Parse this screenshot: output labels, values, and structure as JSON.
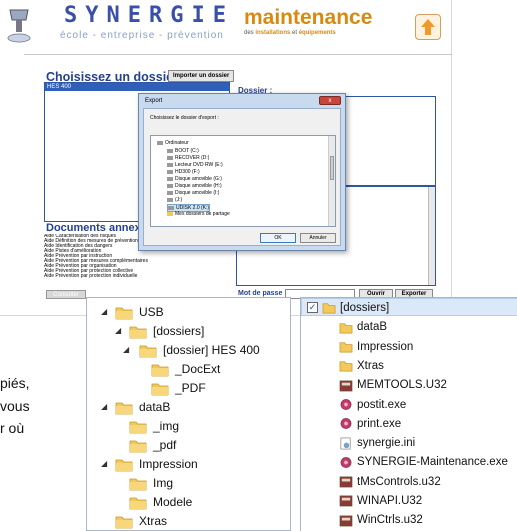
{
  "app": {
    "brand": "SYNERGIE",
    "tagline": "école - entreprise - prévention",
    "maint_title": "maintenance",
    "maint_sub_pre": "des ",
    "maint_sub_b1": "installations",
    "maint_sub_mid": " et ",
    "maint_sub_b2": "équipements",
    "choose_title": "Choisissez un dossier",
    "import_label": "Importer un dossier",
    "folder_selected": "HES 400",
    "dossier_title": "Dossier :",
    "annex_title": "Documents annexes dis",
    "annex_items": [
      "Aide Caractérisation des risques",
      "Aide Définition des mesures de prévention",
      "Aide Identification des dangers",
      "Aide Pistes d'amélioration",
      "Aide Prévention par instruction",
      "Aide Prévention par mesures complémentaires",
      "Aide Prévention par organisation",
      "Aide Prévention par protection collective",
      "Aide Prévention par protection individuelle"
    ],
    "consult_label": "Consulter",
    "password_label": "Mot de passe :",
    "open_label": "Ouvrir",
    "export_label": "Exporter"
  },
  "dialog": {
    "title": "Export",
    "close": "x",
    "prompt": "Choisissez le dossier d'export :",
    "tree": [
      "Ordinateur",
      "BOOT (C:)",
      "RECOVER (D:)",
      "Lecteur DVD RW (E:)",
      "HD300 (F:)",
      "Disque amovible (G:)",
      "Disque amovible (H:)",
      "Disque amovible (I:)",
      "(J:)",
      "UDISK 2.0 (K:)",
      "Mes dossiers de partage"
    ],
    "ok": "OK",
    "cancel": "Annuler"
  },
  "fragments": [
    "piés,",
    "vous",
    "r où"
  ],
  "left_tree": [
    {
      "label": "USB",
      "toggle": "◢"
    },
    {
      "label": "[dossiers]",
      "toggle": "◢"
    },
    {
      "label": "[dossier] HES 400",
      "toggle": "◢"
    },
    {
      "label": "_DocExt",
      "toggle": ""
    },
    {
      "label": "_PDF",
      "toggle": ""
    },
    {
      "label": "dataB",
      "toggle": "◢"
    },
    {
      "label": "_img",
      "toggle": ""
    },
    {
      "label": "_pdf",
      "toggle": ""
    },
    {
      "label": "Impression",
      "toggle": "◢"
    },
    {
      "label": "Img",
      "toggle": ""
    },
    {
      "label": "Modele",
      "toggle": ""
    },
    {
      "label": "Xtras",
      "toggle": ""
    }
  ],
  "right_list": [
    {
      "label": "[dossiers]",
      "icon": "folder"
    },
    {
      "label": "dataB",
      "icon": "folder"
    },
    {
      "label": "Impression",
      "icon": "folder"
    },
    {
      "label": "Xtras",
      "icon": "folder"
    },
    {
      "label": "MEMTOOLS.U32",
      "icon": "u32"
    },
    {
      "label": "postit.exe",
      "icon": "exe"
    },
    {
      "label": "print.exe",
      "icon": "exe"
    },
    {
      "label": "synergie.ini",
      "icon": "ini"
    },
    {
      "label": "SYNERGIE-Maintenance.exe",
      "icon": "exe"
    },
    {
      "label": "tMsControls.u32",
      "icon": "u32"
    },
    {
      "label": "WINAPI.U32",
      "icon": "u32"
    },
    {
      "label": "WinCtrls.u32",
      "icon": "u32"
    }
  ],
  "colors": {
    "brand_blue": "#3a4fa8",
    "maint_orange": "#d88a10",
    "selection": "#dbe8f8"
  }
}
